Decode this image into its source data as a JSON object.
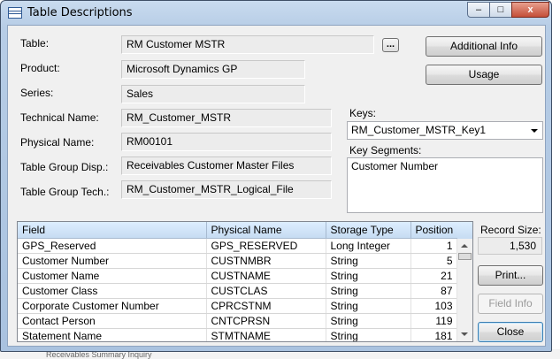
{
  "window": {
    "title": "Table Descriptions",
    "minimize_glyph": "–",
    "maximize_glyph": "□",
    "close_glyph": "x"
  },
  "fields": {
    "table": {
      "label": "Table:",
      "value": "RM Customer MSTR"
    },
    "product": {
      "label": "Product:",
      "value": "Microsoft Dynamics GP"
    },
    "series": {
      "label": "Series:",
      "value": "Sales"
    },
    "technical_name": {
      "label": "Technical Name:",
      "value": "RM_Customer_MSTR"
    },
    "physical_name": {
      "label": "Physical Name:",
      "value": "RM00101"
    },
    "group_disp": {
      "label": "Table Group Disp.:",
      "value": "Receivables Customer Master Files"
    },
    "group_tech": {
      "label": "Table Group Tech.:",
      "value": "RM_Customer_MSTR_Logical_File"
    }
  },
  "lookup_button_label": "...",
  "buttons": {
    "additional_info": "Additional Info",
    "usage": "Usage",
    "print": "Print...",
    "field_info": "Field Info",
    "close": "Close"
  },
  "keys": {
    "label": "Keys:",
    "selected": "RM_Customer_MSTR_Key1",
    "segments_label": "Key Segments:",
    "segments": [
      "Customer Number"
    ]
  },
  "grid": {
    "columns": [
      "Field",
      "Physical Name",
      "Storage Type",
      "Position"
    ],
    "rows": [
      [
        "GPS_Reserved",
        "GPS_RESERVED",
        "Long Integer",
        "1"
      ],
      [
        "Customer Number",
        "CUSTNMBR",
        "String",
        "5"
      ],
      [
        "Customer Name",
        "CUSTNAME",
        "String",
        "21"
      ],
      [
        "Customer Class",
        "CUSTCLAS",
        "String",
        "87"
      ],
      [
        "Corporate Customer Number",
        "CPRCSTNM",
        "String",
        "103"
      ],
      [
        "Contact Person",
        "CNTCPRSN",
        "String",
        "119"
      ],
      [
        "Statement Name",
        "STMTNAME",
        "String",
        "181"
      ]
    ]
  },
  "record_size": {
    "label": "Record Size:",
    "value": "1,530"
  },
  "background_text": "Receivables Summary Inquiry"
}
